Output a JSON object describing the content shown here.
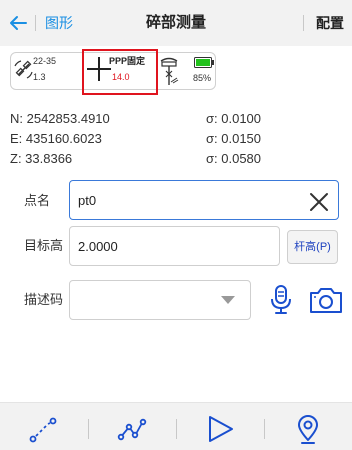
{
  "header": {
    "back_icon": "arrow-left-icon",
    "graph_link": "图形",
    "title": "碎部测量",
    "config_link": "配置"
  },
  "status": {
    "satellite_icon": "satellite-icon",
    "satellites": "22-35",
    "precision": "1.3",
    "fix_icon": "crosshair-icon",
    "fix_label": "PPP固定",
    "diff_age": "14.0",
    "rover_icon": "rover-antenna-icon",
    "battery_icon": "battery-icon",
    "battery_percent": "85%",
    "battery_color": "#22c21c",
    "highlight_color": "#e0141e"
  },
  "coordinates": {
    "n": "N:  2542853.4910",
    "e": "E:  435160.6023",
    "z": "Z:  33.8366",
    "sigma_n": "σ:  0.0100",
    "sigma_e": "σ:  0.0150",
    "sigma_z": "σ:  0.0580"
  },
  "form": {
    "point_name_label": "点名",
    "point_name_value": "pt0",
    "target_height_label": "目标高",
    "target_height_value": "2.0000",
    "rod_height_button": "杆高(P)",
    "description_label": "描述码",
    "description_value": "",
    "accent_color": "#3a79d9"
  },
  "toolbar": {
    "icons": [
      "point-stakeout-icon",
      "line-stakeout-icon",
      "play-icon",
      "location-pin-icon"
    ]
  }
}
